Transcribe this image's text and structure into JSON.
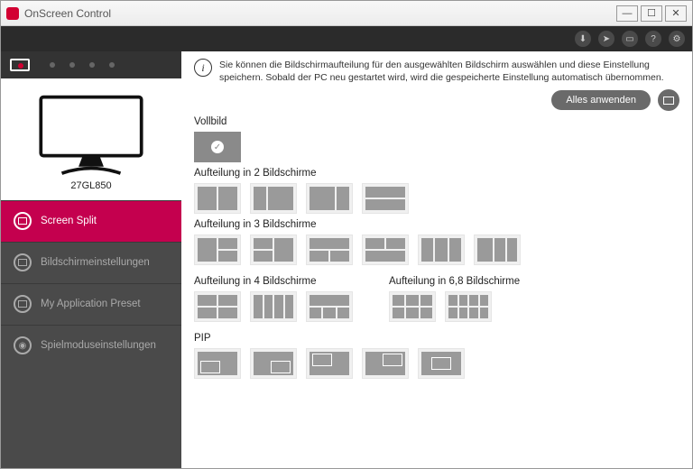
{
  "window": {
    "title": "OnScreen Control"
  },
  "toolbar_icons": [
    "download-icon",
    "cursor-icon",
    "window-icon",
    "help-icon",
    "settings-icon"
  ],
  "monitor": {
    "model": "27GL850"
  },
  "nav": {
    "items": [
      {
        "label": "Screen Split",
        "active": true
      },
      {
        "label": "Bildschirmeinstellungen",
        "active": false
      },
      {
        "label": "My Application Preset",
        "active": false
      },
      {
        "label": "Spielmoduseinstellungen",
        "active": false
      }
    ]
  },
  "info": {
    "text": "Sie können die Bildschirmaufteilung für den ausgewählten Bildschirm auswählen und diese Einstellung speichern. Sobald der PC neu gestartet wird, wird die gespeicherte Einstellung automatisch übernommen."
  },
  "apply": {
    "label": "Alles anwenden"
  },
  "sections": {
    "fullscreen": "Vollbild",
    "split2": "Aufteilung in 2 Bildschirme",
    "split3": "Aufteilung in 3 Bildschirme",
    "split4": "Aufteilung in 4 Bildschirme",
    "split68": "Aufteilung in 6,8 Bildschirme",
    "pip": "PIP"
  }
}
